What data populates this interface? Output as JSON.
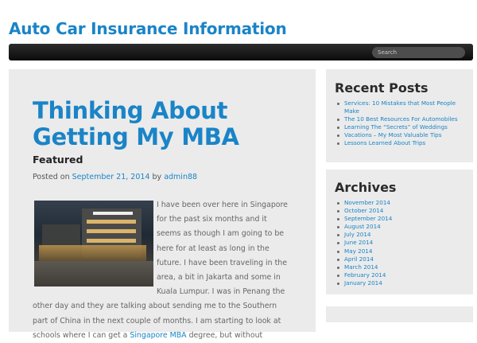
{
  "site": {
    "title": "Auto Car Insurance Information"
  },
  "nav": {
    "search_placeholder": "Search"
  },
  "post": {
    "title": "Thinking About Getting My MBA",
    "featured": "Featured",
    "posted_on": "Posted on",
    "date": "September 21, 2014",
    "by": "by",
    "author": "admin88",
    "body_1": "I have been over here in Singapore for the past six months and it seems as though I am going to be here for at least as long in the future. I have been traveling in the area, a bit in Jakarta and some in Kuala Lumpur. I was in Penang the other day and they are talking about sending me to the Southern part of China in the next couple of months. I am starting to look at schools where I can get a",
    "body_link": "Singapore MBA",
    "body_2": "degree, but without"
  },
  "sidebar": {
    "recent_posts": {
      "title": "Recent Posts",
      "items": [
        "Services: 10 Mistakes that Most People Make",
        "The 10 Best Resources For Automobiles",
        "Learning The “Secrets” of Weddings",
        "Vacations – My Most Valuable Tips",
        "Lessons Learned About Trips"
      ]
    },
    "archives": {
      "title": "Archives",
      "items": [
        "November 2014",
        "October 2014",
        "September 2014",
        "August 2014",
        "July 2014",
        "June 2014",
        "May 2014",
        "April 2014",
        "March 2014",
        "February 2014",
        "January 2014"
      ]
    }
  },
  "colors": {
    "link": "#1a84c7",
    "nav": "#1a1a1a",
    "panel": "#ebebeb"
  }
}
